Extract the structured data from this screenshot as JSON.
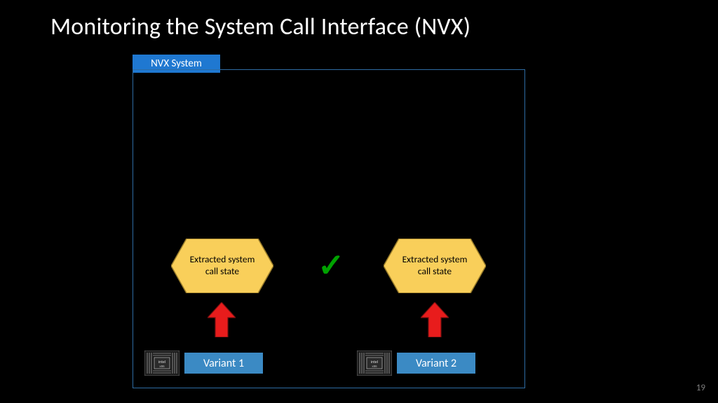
{
  "slide": {
    "title": "Monitoring the System Call Interface (NVX)",
    "number": "19"
  },
  "nvx": {
    "tab": "NVX System",
    "hex_left": "Extracted system call state",
    "hex_right": "Extracted system call state",
    "check": "✓",
    "variant1": "Variant 1",
    "variant2": "Variant 2",
    "chip1_label": "intel x86",
    "chip2_label": "intel x86"
  }
}
